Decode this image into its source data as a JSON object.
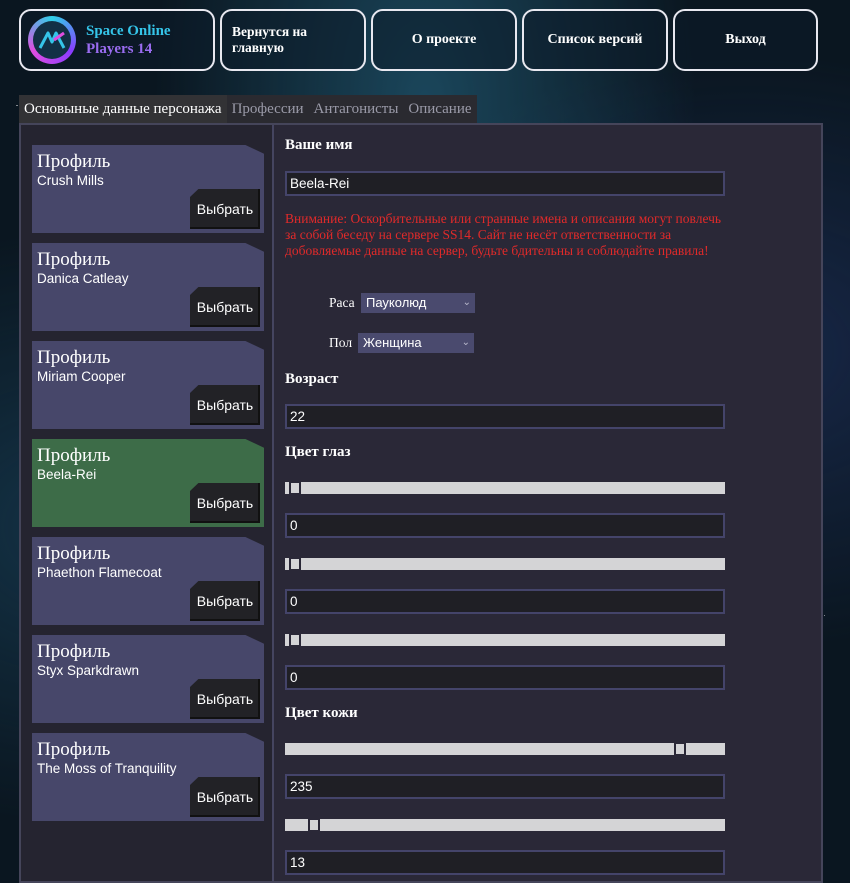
{
  "header": {
    "logo_line1": "Space Online",
    "logo_line2": "Players 14",
    "nav": [
      "Вернутся на главную",
      "О проекте",
      "Список версий",
      "Выход"
    ]
  },
  "tabs": [
    {
      "label": "Основыные данные персонажа",
      "active": true
    },
    {
      "label": "Профессии",
      "active": false
    },
    {
      "label": "Антагонисты",
      "active": false
    },
    {
      "label": "Описание",
      "active": false
    }
  ],
  "profiles": [
    {
      "title": "Профиль",
      "name": "Crush Mills",
      "button": "Выбрать",
      "active": false
    },
    {
      "title": "Профиль",
      "name": "Danica Catleay",
      "button": "Выбрать",
      "active": false
    },
    {
      "title": "Профиль",
      "name": "Miriam Cooper",
      "button": "Выбрать",
      "active": false
    },
    {
      "title": "Профиль",
      "name": "Beela-Rei",
      "button": "Выбрать",
      "active": true
    },
    {
      "title": "Профиль",
      "name": "Phaethon Flamecoat",
      "button": "Выбрать",
      "active": false
    },
    {
      "title": "Профиль",
      "name": "Styx Sparkdrawn",
      "button": "Выбрать",
      "active": false
    },
    {
      "title": "Профиль",
      "name": "The Moss of Tranquility",
      "button": "Выбрать",
      "active": false
    }
  ],
  "form": {
    "name_heading": "Ваше имя",
    "name_value": "Beela-Rei",
    "warning": "Внимание: Оскорбительные или странные имена и описания могут повлечь за собой беседу на сервере SS14. Сайт не несёт ответственности за добовляемые данные на сервер, будьте бдительны и соблюдайте правила!",
    "race_label": "Раса",
    "race_value": "Пауколюд",
    "gender_label": "Пол",
    "gender_value": "Женщина",
    "age_heading": "Возраст",
    "age_value": "22",
    "eye_heading": "Цвет глаз",
    "eye_values": [
      "0",
      "0",
      "0"
    ],
    "skin_heading": "Цвет кожи",
    "skin_values": [
      "235",
      "13"
    ]
  },
  "colors": {
    "profile_bg": "#47476a",
    "profile_active": "#3d6c48",
    "warning": "#e02a2a",
    "logo_cyan": "#35c4e8",
    "logo_purple": "#9a6cf0"
  }
}
